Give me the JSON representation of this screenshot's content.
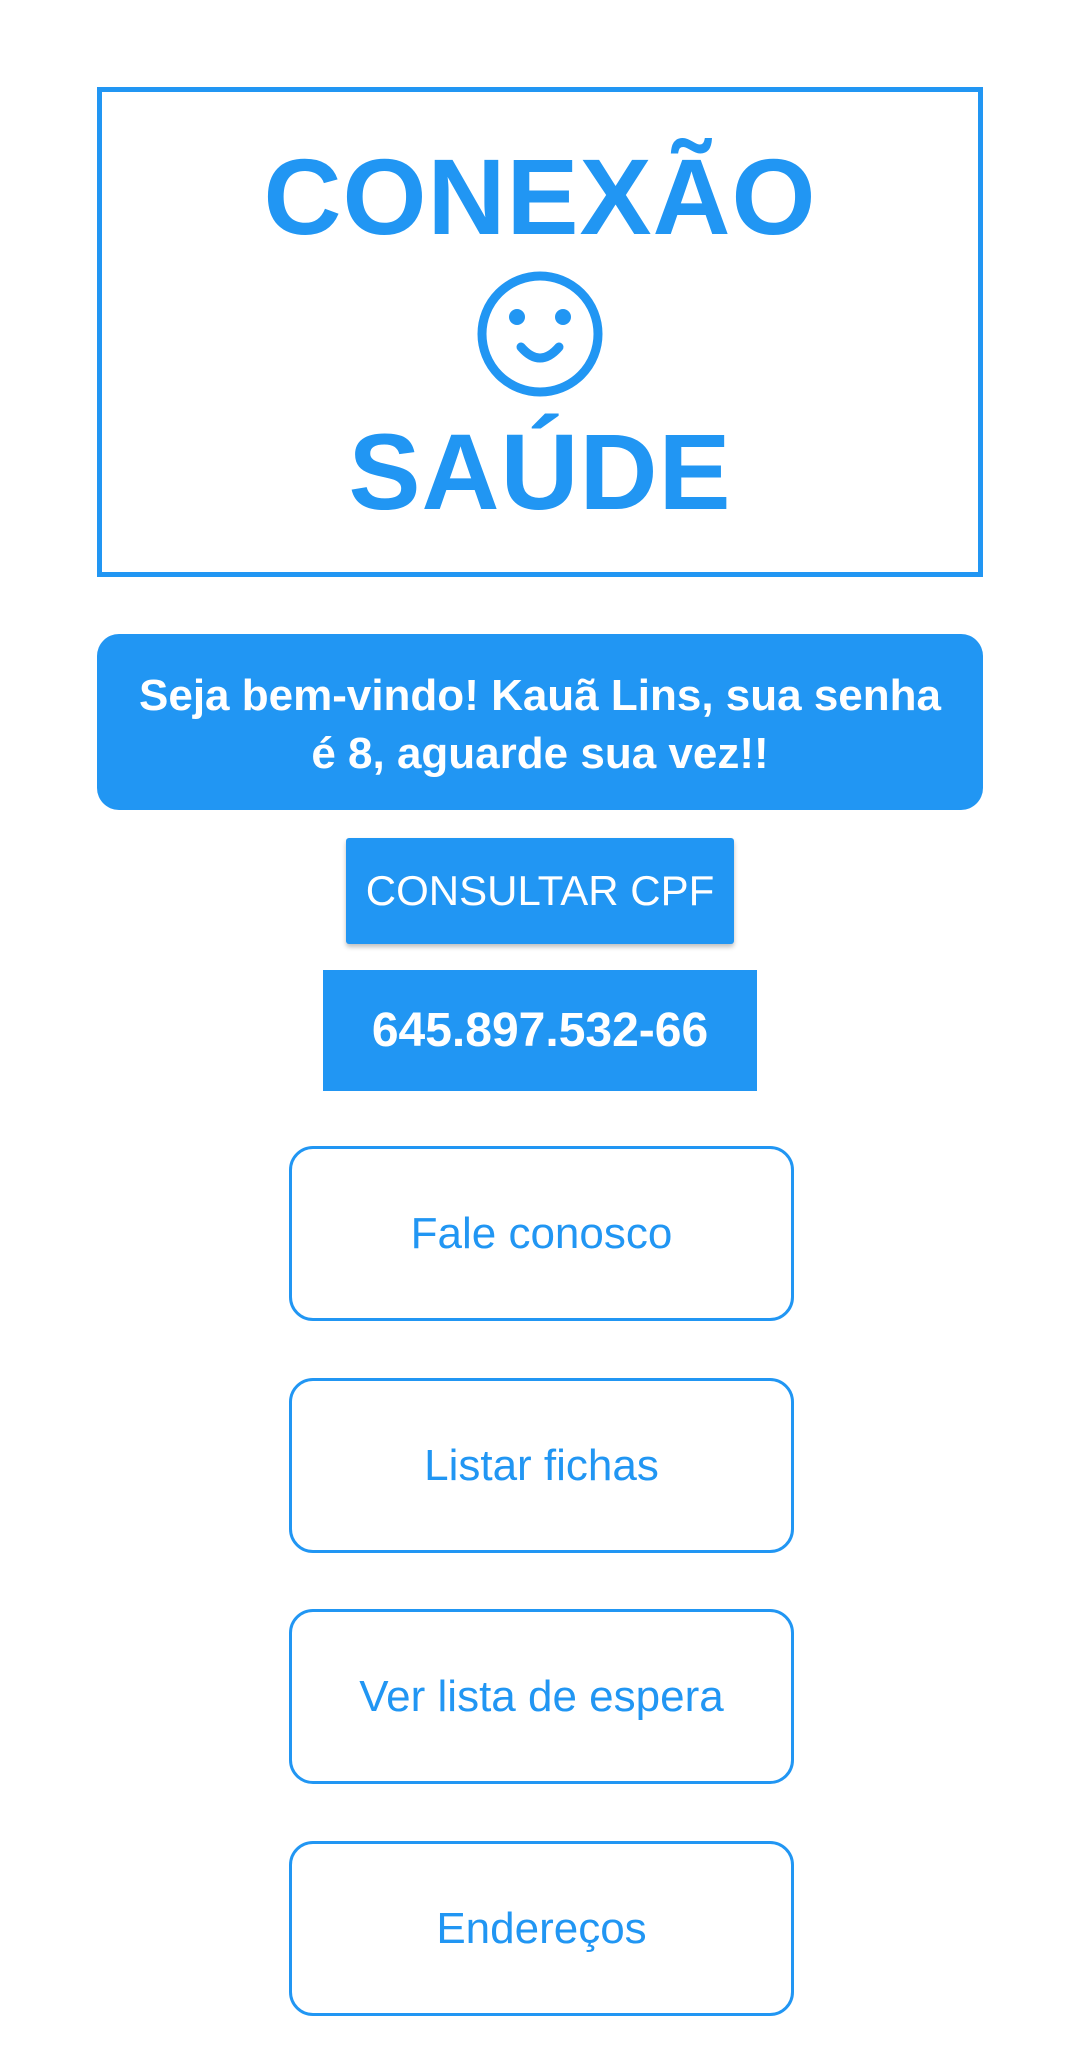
{
  "logo": {
    "line1": "CONEXÃO",
    "line2": "SAÚDE",
    "icon": "smiley-face-icon",
    "color": "#2196f3"
  },
  "welcome": {
    "message": "Seja bem-vindo! Kauã Lins, sua senha é 8, aguarde sua vez!!"
  },
  "cpf": {
    "button_label": "CONSULTAR CPF",
    "value": "645.897.532-66"
  },
  "menu": {
    "items": [
      {
        "label": "Fale conosco"
      },
      {
        "label": "Listar fichas"
      },
      {
        "label": "Ver lista de espera"
      },
      {
        "label": "Endereços"
      }
    ]
  },
  "colors": {
    "accent": "#2196f3",
    "background": "#ffffff",
    "on_accent_text": "#ffffff"
  }
}
